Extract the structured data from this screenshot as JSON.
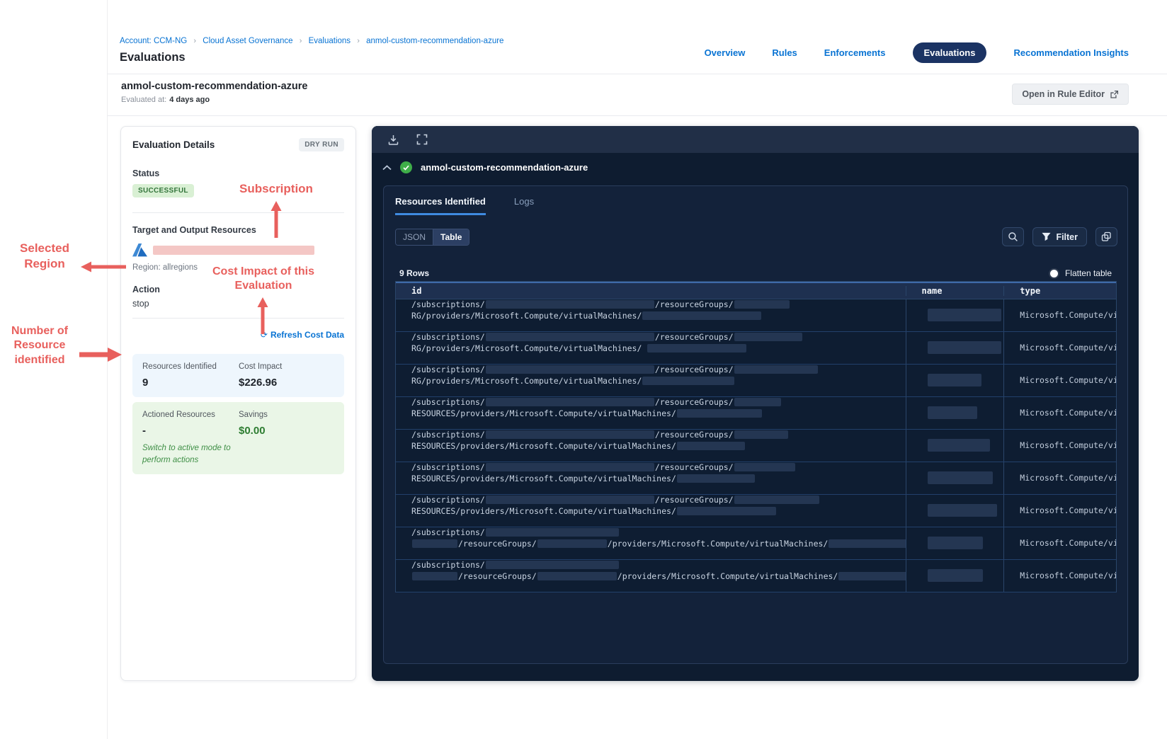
{
  "breadcrumb": {
    "account": "Account: CCM-NG",
    "separator": "›",
    "items": [
      "Cloud Asset Governance",
      "Evaluations",
      "anmol-custom-recommendation-azure"
    ]
  },
  "page": {
    "title": "Evaluations"
  },
  "nav": {
    "tabs": [
      {
        "label": "Overview"
      },
      {
        "label": "Rules"
      },
      {
        "label": "Enforcements"
      },
      {
        "label": "Evaluations",
        "active": true
      },
      {
        "label": "Recommendation Insights"
      }
    ]
  },
  "subheader": {
    "title": "anmol-custom-recommendation-azure",
    "evaluated_label": "Evaluated at:",
    "evaluated_value": "4 days ago",
    "open_rule_editor": "Open in Rule Editor"
  },
  "details": {
    "title": "Evaluation Details",
    "mode_badge": "DRY RUN",
    "status_label": "Status",
    "status_value": "SUCCESSFUL",
    "target_label": "Target and Output Resources",
    "region": "Region: allregions",
    "action_label": "Action",
    "action_value": "stop",
    "refresh_link": "Refresh Cost Data",
    "resources_identified_label": "Resources Identified",
    "resources_identified_value": "9",
    "cost_impact_label": "Cost Impact",
    "cost_impact_value": "$226.96",
    "actioned_label": "Actioned Resources",
    "actioned_value": "-",
    "savings_label": "Savings",
    "savings_value": "$0.00",
    "active_mode_note": "Switch to active mode to perform actions"
  },
  "annotations": {
    "color": "#e8605d",
    "subscription": "Subscription",
    "selected_region": "Selected Region",
    "cost_impact": "Cost Impact of this Evaluation",
    "resources_count": "Number of Resource identified"
  },
  "results_panel": {
    "title": "anmol-custom-recommendation-azure",
    "tabs": [
      {
        "label": "Resources Identified",
        "active": true
      },
      {
        "label": "Logs",
        "active": false
      }
    ],
    "view_toggle": [
      "JSON",
      "Table"
    ],
    "view_selected": "Table",
    "filter_label": "Filter",
    "rows_count": "9 Rows",
    "flatten_label": "Flatten table",
    "table": {
      "columns": [
        "id",
        "name",
        "type"
      ],
      "type_value": "Microsoft.Compute/virtu",
      "rows": [
        {
          "name_w": 104,
          "lines": [
            [
              {
                "t": "/subscriptions/"
              },
              {
                "r": 238
              },
              {
                "t": "/resourceGroups/"
              },
              {
                "r": 78
              }
            ],
            [
              {
                "t": "RG/providers/Microsoft.Compute/virtualMachines/"
              },
              {
                "r": 168
              }
            ]
          ]
        },
        {
          "name_w": 104,
          "lines": [
            [
              {
                "t": "/subscriptions/"
              },
              {
                "r": 238
              },
              {
                "t": "/resourceGroups/"
              },
              {
                "r": 96
              }
            ],
            [
              {
                "t": "RG/providers/Microsoft.Compute/virtualMachines/ "
              },
              {
                "r": 140
              }
            ]
          ]
        },
        {
          "name_w": 76,
          "lines": [
            [
              {
                "t": "/subscriptions/"
              },
              {
                "r": 238
              },
              {
                "t": "/resourceGroups/"
              },
              {
                "r": 118
              }
            ],
            [
              {
                "t": "RG/providers/Microsoft.Compute/virtualMachines/"
              },
              {
                "r": 130
              }
            ]
          ]
        },
        {
          "name_w": 70,
          "lines": [
            [
              {
                "t": "/subscriptions/"
              },
              {
                "r": 238
              },
              {
                "t": "/resourceGroups/"
              },
              {
                "r": 66
              }
            ],
            [
              {
                "t": "RESOURCES/providers/Microsoft.Compute/virtualMachines/"
              },
              {
                "r": 120
              }
            ]
          ]
        },
        {
          "name_w": 88,
          "lines": [
            [
              {
                "t": "/subscriptions/"
              },
              {
                "r": 238
              },
              {
                "t": "/resourceGroups/"
              },
              {
                "r": 76
              }
            ],
            [
              {
                "t": "RESOURCES/providers/Microsoft.Compute/virtualMachines/"
              },
              {
                "r": 96
              }
            ]
          ]
        },
        {
          "name_w": 92,
          "lines": [
            [
              {
                "t": "/subscriptions/"
              },
              {
                "r": 238
              },
              {
                "t": "/resourceGroups/"
              },
              {
                "r": 86
              }
            ],
            [
              {
                "t": "RESOURCES/providers/Microsoft.Compute/virtualMachines/"
              },
              {
                "r": 110
              }
            ]
          ]
        },
        {
          "name_w": 98,
          "lines": [
            [
              {
                "t": "/subscriptions/"
              },
              {
                "r": 238
              },
              {
                "t": "/resourceGroups/"
              },
              {
                "r": 120
              }
            ],
            [
              {
                "t": "RESOURCES/providers/Microsoft.Compute/virtualMachines/"
              },
              {
                "r": 140
              }
            ]
          ]
        },
        {
          "name_w": 78,
          "lines": [
            [
              {
                "t": "/subscriptions/"
              },
              {
                "r": 188
              }
            ],
            [
              {
                "r": 64
              },
              {
                "t": "/resourceGroups/"
              },
              {
                "r": 98
              },
              {
                "t": "/providers/Microsoft.Compute/virtualMachines/"
              },
              {
                "r": 210
              }
            ]
          ]
        },
        {
          "name_w": 78,
          "lines": [
            [
              {
                "t": "/subscriptions/"
              },
              {
                "r": 188
              }
            ],
            [
              {
                "r": 64
              },
              {
                "t": "/resourceGroups/"
              },
              {
                "r": 112
              },
              {
                "t": "/providers/Microsoft.Compute/virtualMachines/"
              },
              {
                "r": 178
              }
            ]
          ]
        }
      ]
    }
  }
}
